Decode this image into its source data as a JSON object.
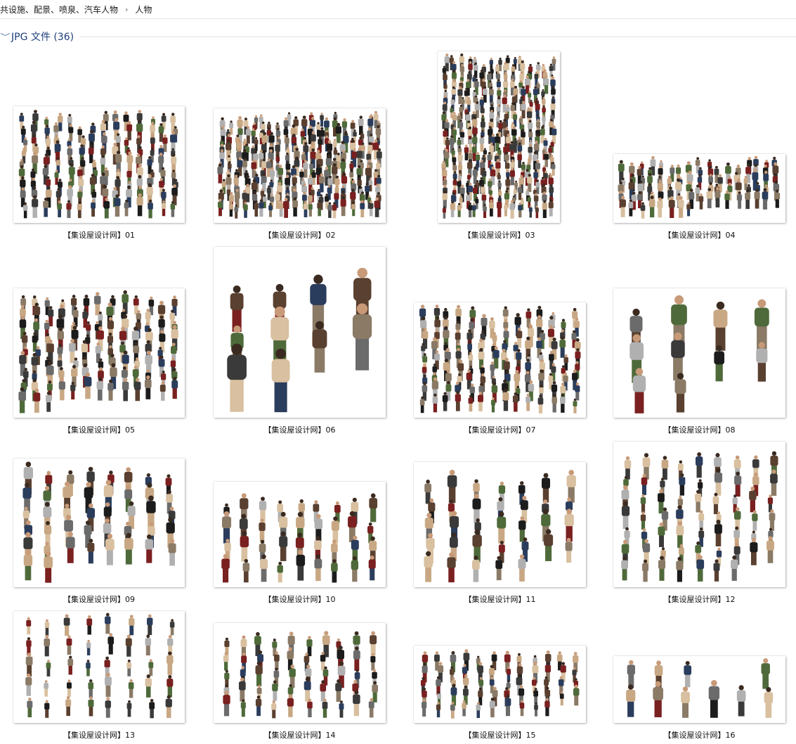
{
  "breadcrumb": {
    "items": [
      "共设施、配景、喷泉、汽车人物",
      "人物"
    ],
    "separator": "›"
  },
  "group": {
    "chevron": "﹀",
    "title": "JPG 文件 (36)"
  },
  "files": [
    {
      "name": "【集设屋设计网】01"
    },
    {
      "name": "【集设屋设计网】02"
    },
    {
      "name": "【集设屋设计网】03"
    },
    {
      "name": "【集设屋设计网】04"
    },
    {
      "name": "【集设屋设计网】05"
    },
    {
      "name": "【集设屋设计网】06"
    },
    {
      "name": "【集设屋设计网】07"
    },
    {
      "name": "【集设屋设计网】08"
    },
    {
      "name": "【集设屋设计网】09"
    },
    {
      "name": "【集设屋设计网】10"
    },
    {
      "name": "【集设屋设计网】11"
    },
    {
      "name": "【集设屋设计网】12"
    },
    {
      "name": "【集设屋设计网】13"
    },
    {
      "name": "【集设屋设计网】14"
    },
    {
      "name": "【集设屋设计网】15"
    },
    {
      "name": "【集设屋设计网】16"
    }
  ],
  "colors": {
    "link": "#1e3f7a",
    "people": [
      "#1c1c1c",
      "#3a3a3a",
      "#6b6b6b",
      "#8a7a66",
      "#c8a884",
      "#2b3d5c",
      "#7a2020",
      "#4f6a3a",
      "#b0b0b0",
      "#d8c0a0",
      "#5a4030"
    ]
  }
}
